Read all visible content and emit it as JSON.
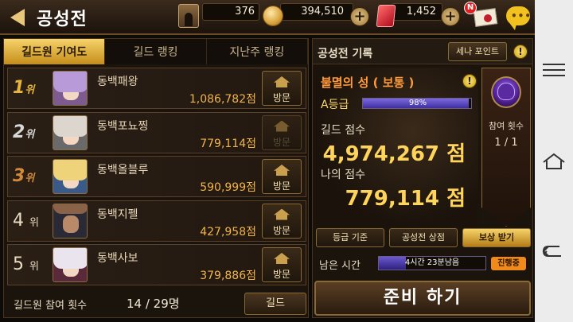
{
  "header": {
    "title": "공성전",
    "resources": {
      "gate": "376",
      "gold": "394,510",
      "gem": "1,452"
    },
    "mail_badge": "N",
    "chat_dots": "•••"
  },
  "left_panel": {
    "tabs": [
      {
        "label": "길드원 기여도",
        "active": true
      },
      {
        "label": "길드 랭킹",
        "active": false
      },
      {
        "label": "지난주 랭킹",
        "active": false
      }
    ],
    "rows": [
      {
        "rank": "1",
        "rank_suffix": "위",
        "name": "동백패왕",
        "score": "1,086,782점",
        "visit": "방문",
        "visit_enabled": true,
        "hair": "#b99ad8"
      },
      {
        "rank": "2",
        "rank_suffix": "위",
        "name": "동백포뇨찡",
        "score": "779,114점",
        "visit": "방문",
        "visit_enabled": false,
        "hair": "#ddd6cf"
      },
      {
        "rank": "3",
        "rank_suffix": "위",
        "name": "동백올블루",
        "score": "590,999점",
        "visit": "방문",
        "visit_enabled": true,
        "hair": "#efd37a"
      },
      {
        "rank": "4",
        "rank_suffix": "위",
        "name": "동백지펠",
        "score": "427,958점",
        "visit": "방문",
        "visit_enabled": true,
        "hair": "#8a6248"
      },
      {
        "rank": "5",
        "rank_suffix": "위",
        "name": "동백사보",
        "score": "379,886점",
        "visit": "방문",
        "visit_enabled": true,
        "hair": "#eae4ef"
      }
    ],
    "participation_label": "길드원 참여 횟수",
    "participation_count": "14 / 29명",
    "guild_button": "길드"
  },
  "right_panel": {
    "title": "공성전 기록",
    "sena_point_button": "세나 포인트",
    "castle_name": "불멸의 성 ( 보통 )",
    "grade_label": "A등급",
    "grade_percent": "98%",
    "grade_progress": 0.98,
    "guild_score_label": "길드 점수",
    "guild_score": "4,974,267 점",
    "my_score_label": "나의 점수",
    "my_score": "779,114 점",
    "participation_banner_label": "참여 횟수",
    "participation_banner_value": "1 / 1",
    "buttons": {
      "grade_criteria": "등급 기준",
      "siege_shop": "공성전 상점",
      "claim_reward": "보상 받기"
    },
    "remaining_label": "남은 시간",
    "remaining_time": "4시간 23분남음",
    "remaining_progress": 0.25,
    "status": "진행중",
    "ready_button": "준비 하기"
  },
  "colors": {
    "accent_gold": "#ffd45a",
    "score_orange": "#f0b44a",
    "tab_active": "#f6d36a",
    "status": "#f08a1a"
  }
}
